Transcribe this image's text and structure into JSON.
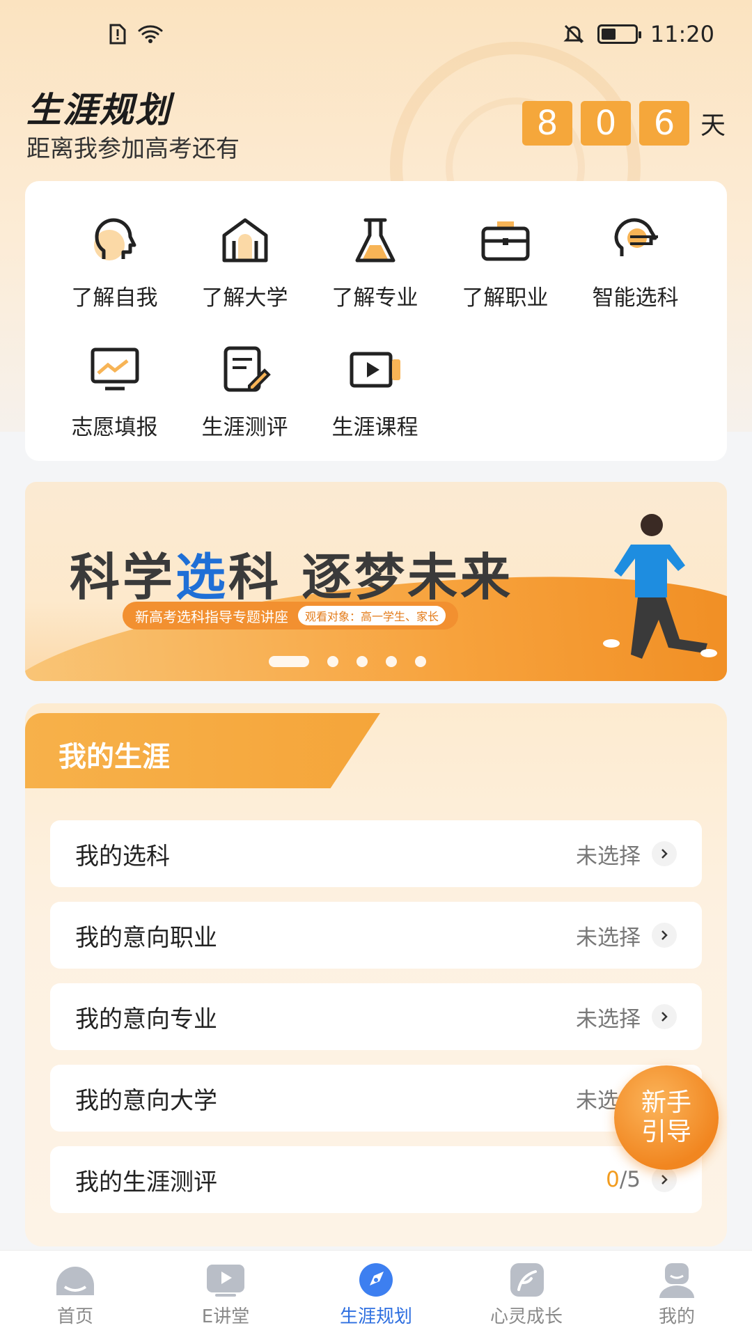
{
  "status_bar": {
    "time": "11:20"
  },
  "header": {
    "title": "生涯规划",
    "countdown_label": "距离我参加高考还有",
    "countdown_digits": [
      "8",
      "0",
      "6"
    ],
    "countdown_unit": "天"
  },
  "menu": {
    "items": [
      {
        "label": "了解自我",
        "icon": "head-profile-icon"
      },
      {
        "label": "了解大学",
        "icon": "university-building-icon"
      },
      {
        "label": "了解专业",
        "icon": "flask-icon"
      },
      {
        "label": "了解职业",
        "icon": "briefcase-icon"
      },
      {
        "label": "智能选科",
        "icon": "brain-chip-icon"
      },
      {
        "label": "志愿填报",
        "icon": "monitor-chart-icon"
      },
      {
        "label": "生涯测评",
        "icon": "test-paper-pen-icon"
      },
      {
        "label": "生涯课程",
        "icon": "video-play-icon"
      }
    ]
  },
  "banner": {
    "title_part1": "科学",
    "title_part2": "选",
    "title_part3": "科",
    "title_part4": "逐梦未来",
    "subtitle": "新高考选科指导专题讲座",
    "tag": "观看对象：高一学生、家长",
    "slide_count": 5,
    "active_slide": 1
  },
  "career": {
    "title": "我的生涯",
    "rows": [
      {
        "label": "我的选科",
        "value": "未选择"
      },
      {
        "label": "我的意向职业",
        "value": "未选择"
      },
      {
        "label": "我的意向专业",
        "value": "未选择"
      },
      {
        "label": "我的意向大学",
        "value": "未选择"
      },
      {
        "label": "我的生涯测评",
        "value_num": "0",
        "value_rest": "/5"
      }
    ]
  },
  "guide_button": {
    "line1": "新手",
    "line2": "引导"
  },
  "bottom_nav": {
    "items": [
      {
        "label": "首页",
        "icon": "home-icon"
      },
      {
        "label": "E讲堂",
        "icon": "video-lecture-icon"
      },
      {
        "label": "生涯规划",
        "icon": "compass-icon",
        "active": true
      },
      {
        "label": "心灵成长",
        "icon": "leaf-icon"
      },
      {
        "label": "我的",
        "icon": "user-icon"
      }
    ]
  },
  "colors": {
    "accent": "#f5a73b",
    "nav_active": "#2e6fe0"
  }
}
